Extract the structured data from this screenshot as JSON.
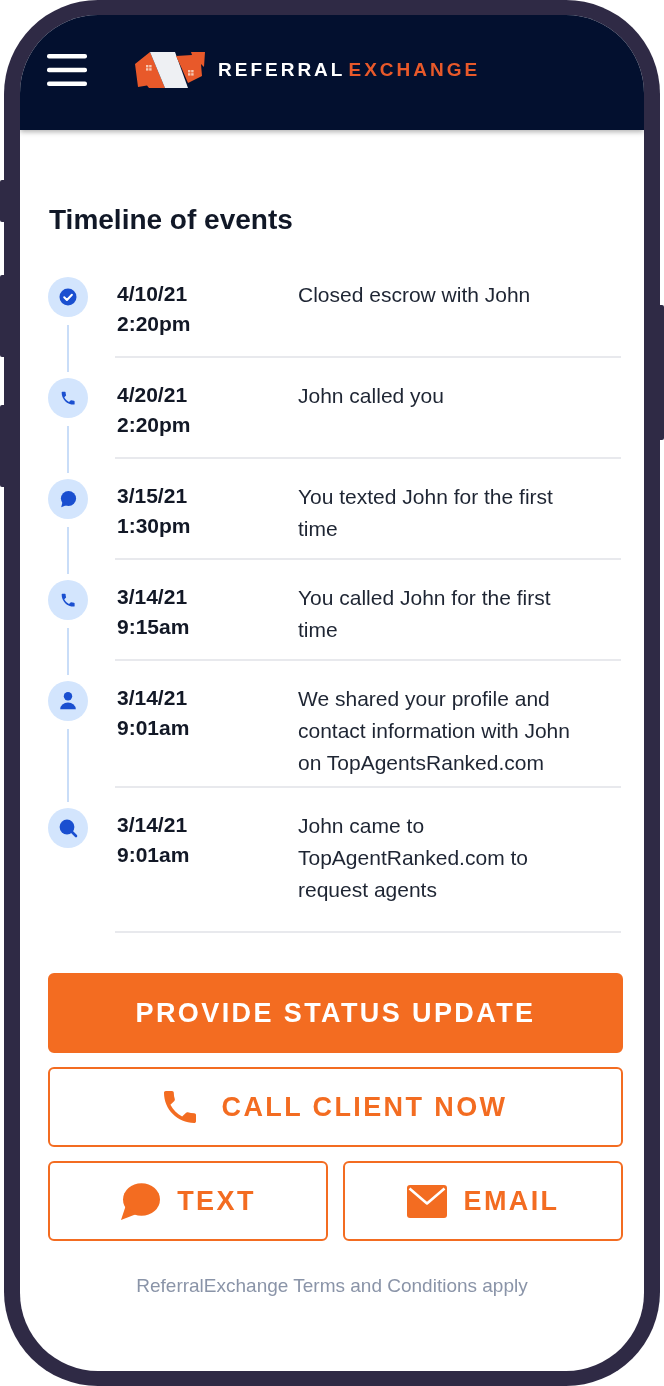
{
  "header": {
    "brand": {
      "first_word": "REFERRAL",
      "second_word": "EXCHANGE"
    }
  },
  "timeline": {
    "title": "Timeline of events",
    "events": [
      {
        "kind": "check",
        "date": "4/10/21",
        "time": "2:20pm",
        "description": "Closed escrow with John"
      },
      {
        "kind": "phone",
        "date": "4/20/21",
        "time": "2:20pm",
        "description": "John called you"
      },
      {
        "kind": "message",
        "date": "3/15/21",
        "time": "1:30pm",
        "description": "You texted John for the first time"
      },
      {
        "kind": "phone",
        "date": "3/14/21",
        "time": "9:15am",
        "description": "You called John for the first time"
      },
      {
        "kind": "person",
        "date": "3/14/21",
        "time": "9:01am",
        "description": "We shared your profile and contact information with John on TopAgentsRanked.com"
      },
      {
        "kind": "search",
        "date": "3/14/21",
        "time": "9:01am",
        "description": "John came to TopAgentRanked.com to request agents"
      }
    ]
  },
  "actions": [
    {
      "kind": "status",
      "label": "PROVIDE STATUS UPDATE"
    },
    {
      "kind": "call",
      "label": "CALL CLIENT NOW"
    },
    {
      "kind": "text",
      "label": "TEXT"
    },
    {
      "kind": "email",
      "label": "EMAIL"
    }
  ],
  "footer": {
    "note": "ReferralExchange Terms and Conditions apply"
  }
}
